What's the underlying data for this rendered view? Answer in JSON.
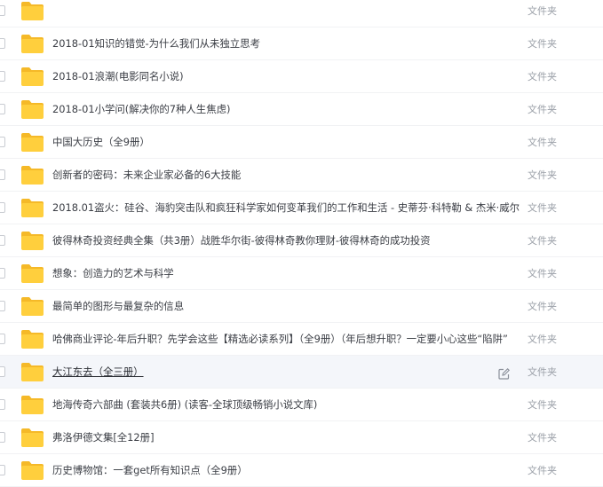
{
  "list": {
    "items": [
      {
        "name": "",
        "type": "文件夹"
      },
      {
        "name": "2018-01知识的错觉-为什么我们从未独立思考",
        "type": "文件夹"
      },
      {
        "name": "2018-01浪潮(电影同名小说)",
        "type": "文件夹"
      },
      {
        "name": "2018-01小学问(解决你的7种人生焦虑)",
        "type": "文件夹"
      },
      {
        "name": "中国大历史（全9册）",
        "type": "文件夹"
      },
      {
        "name": "创新者的密码：未来企业家必备的6大技能",
        "type": "文件夹"
      },
      {
        "name": "2018.01盗火：硅谷、海豹突击队和疯狂科学家如何变革我们的工作和生活 - 史蒂芬·科特勒 & 杰米·威尔",
        "type": "文件夹"
      },
      {
        "name": "彼得林奇投资经典全集（共3册）战胜华尔街-彼得林奇教你理财-彼得林奇的成功投资",
        "type": "文件夹"
      },
      {
        "name": "想象：创造力的艺术与科学",
        "type": "文件夹"
      },
      {
        "name": "最简单的图形与最复杂的信息",
        "type": "文件夹"
      },
      {
        "name": "哈佛商业评论-年后升职？先学会这些【精选必读系列】（全9册）（年后想升职？一定要小心这些“陷阱”",
        "type": "文件夹"
      },
      {
        "name": "大江东去（全三册）",
        "type": "文件夹",
        "hovered": true
      },
      {
        "name": "地海传奇六部曲 (套装共6册) (读客-全球顶级畅销小说文库)",
        "type": "文件夹"
      },
      {
        "name": "弗洛伊德文集[全12册]",
        "type": "文件夹"
      },
      {
        "name": "历史博物馆：一套get所有知识点（全9册）",
        "type": "文件夹"
      }
    ]
  },
  "colors": {
    "folder": "#ffcf3d",
    "folder_tab": "#f5b928",
    "hover_bg": "#f4f6fa"
  },
  "icons": {
    "row_icon": "folder-icon",
    "hover_action": "edit-icon"
  }
}
